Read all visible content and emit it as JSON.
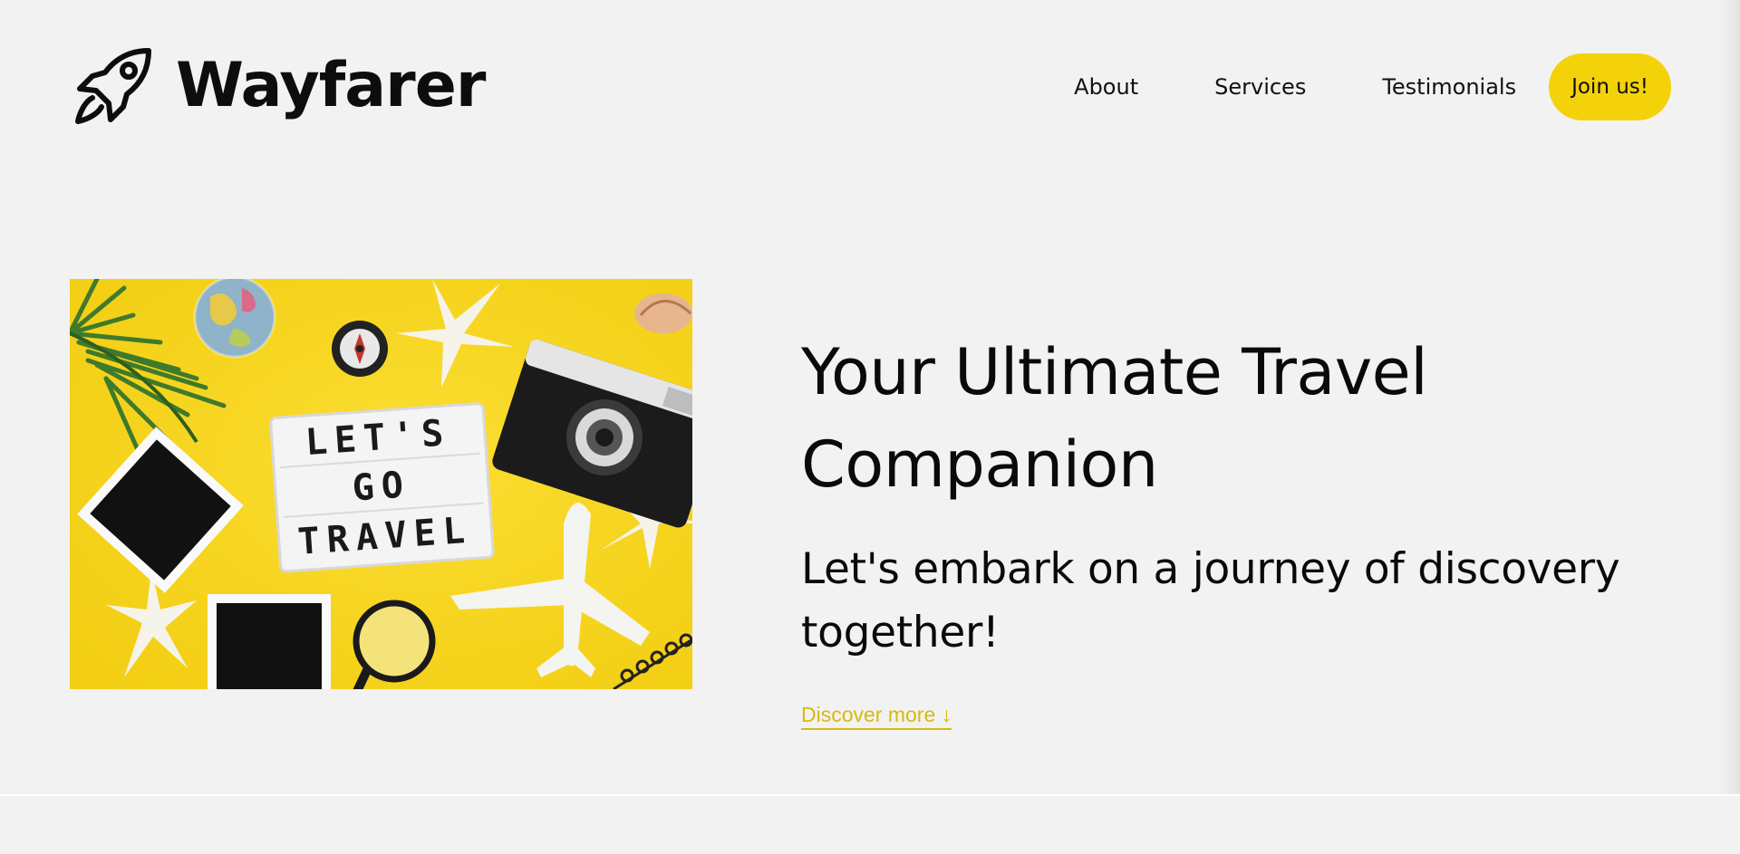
{
  "brand": {
    "name": "Wayfarer",
    "icon": "rocket-icon"
  },
  "nav": {
    "items": [
      {
        "label": "About"
      },
      {
        "label": "Services"
      },
      {
        "label": "Testimonials"
      }
    ],
    "cta_label": "Join us!"
  },
  "hero": {
    "image": {
      "icon": "travel-flatlay-photo",
      "lightbox_text": [
        "LET'S",
        "GO",
        "TRAVEL"
      ]
    },
    "title": "Your Ultimate Travel Companion",
    "subtitle": "Let's embark on a journey of discovery together!",
    "discover_label": "Discover more ↓"
  },
  "colors": {
    "background": "#f2f2f2",
    "accent": "#f3d20a",
    "link": "#d9b90c",
    "text": "#0d0d0d"
  }
}
